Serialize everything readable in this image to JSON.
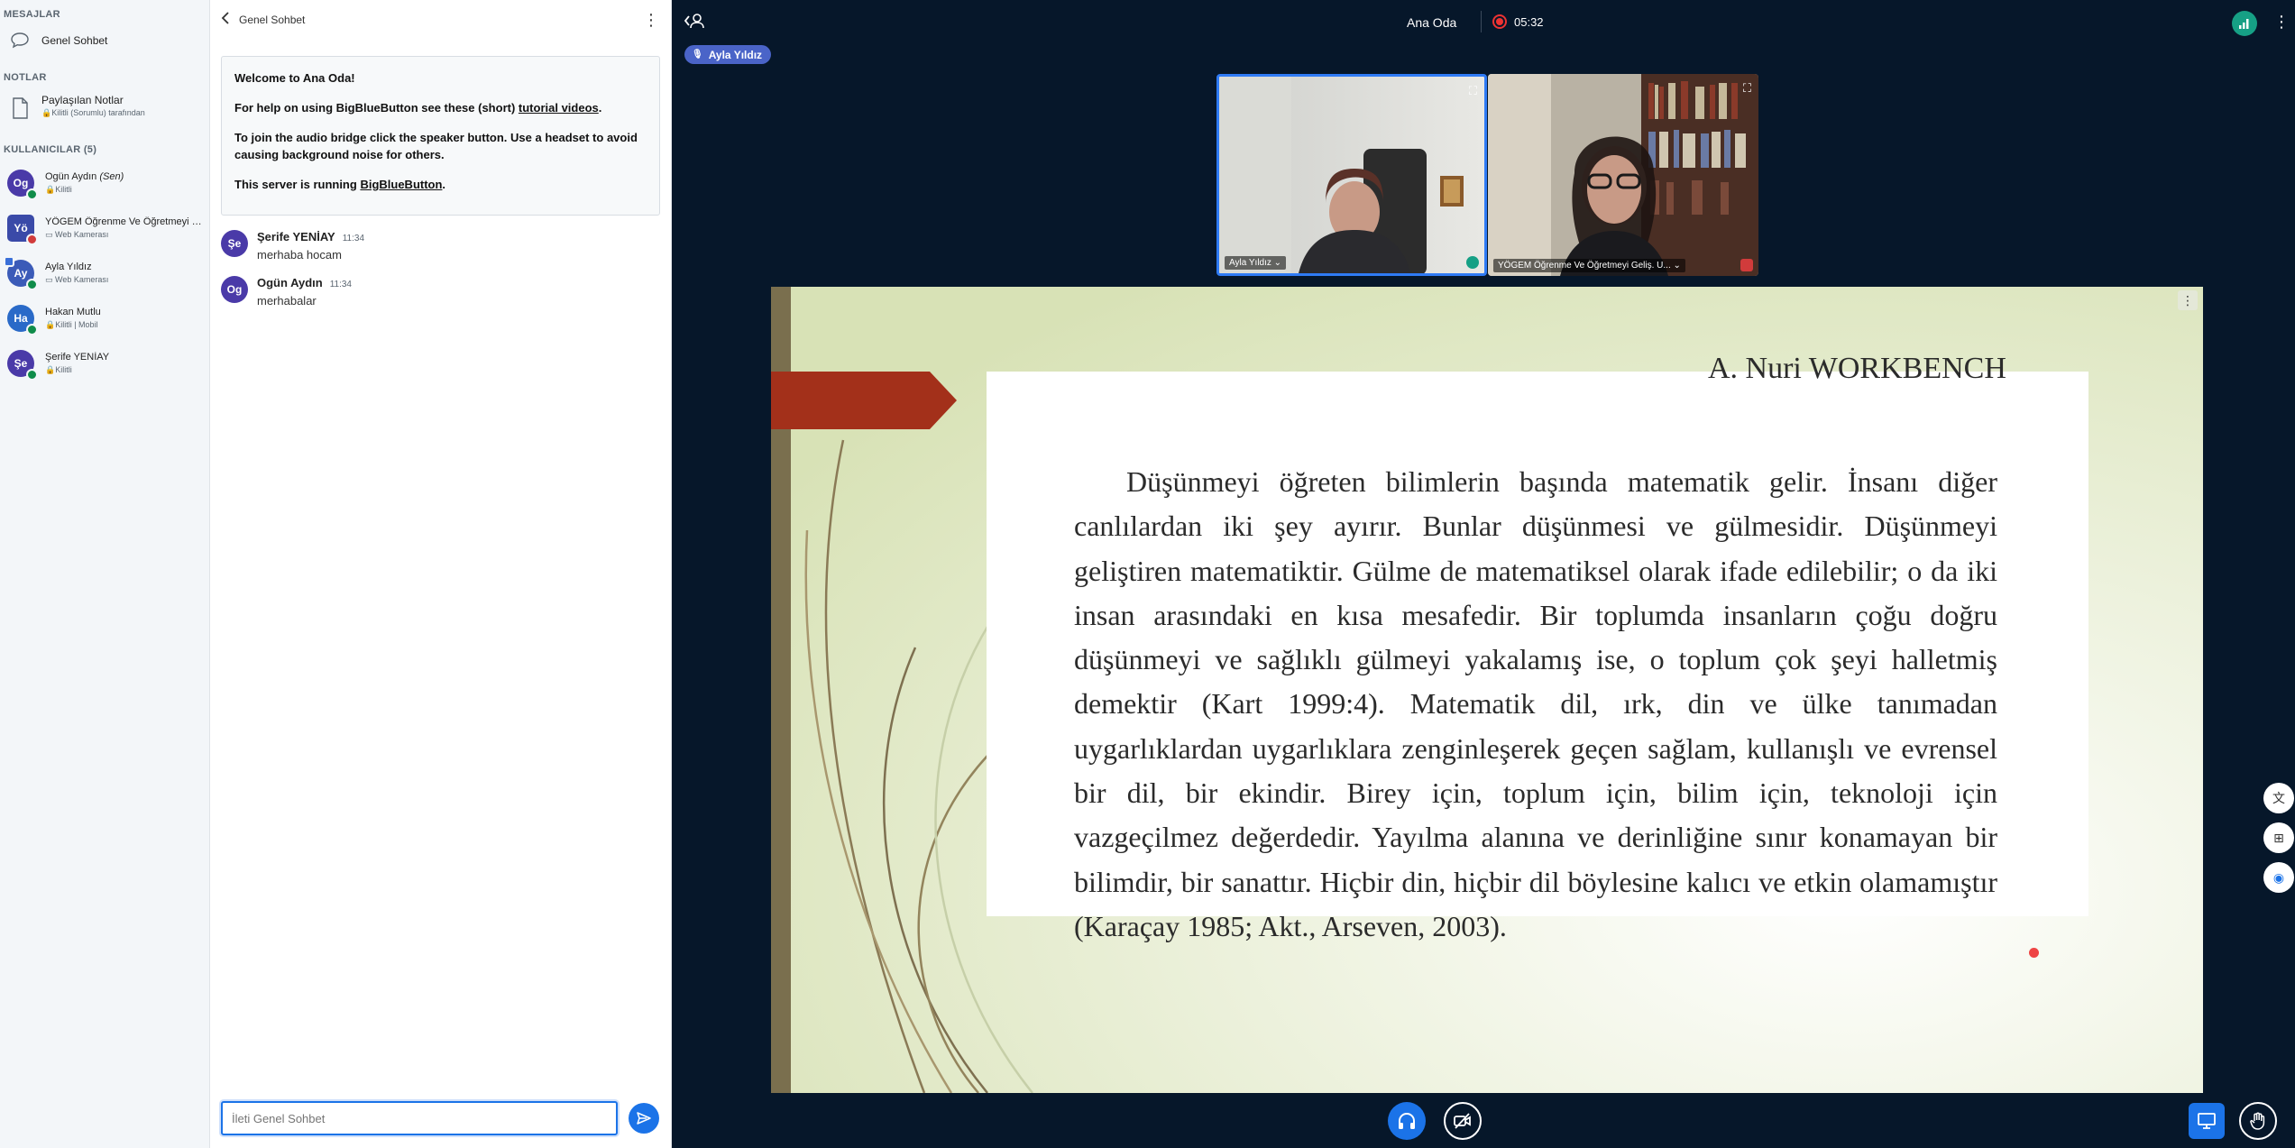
{
  "userlist": {
    "messages_title": "MESAJLAR",
    "public_chat_label": "Genel Sohbet",
    "notes_title": "NOTLAR",
    "shared_notes_label": "Paylaşılan Notlar",
    "shared_notes_sub": "Kilitli (Sorumlu) tarafından",
    "users_title": "KULLANICILAR (5)",
    "users": [
      {
        "initials": "Og",
        "name": "Ogün Aydın",
        "you": "(Sen)",
        "sub": "Kilitli",
        "color": "#4a3aa8"
      },
      {
        "initials": "Yö",
        "name": "YÖGEM Öğrenme Ve Öğretmeyi Geliş...",
        "sub": "Web Kamerası",
        "color": "#3a4aa8"
      },
      {
        "initials": "Ay",
        "name": "Ayla Yıldız",
        "sub": "Web Kamerası",
        "color": "#3b5bb8"
      },
      {
        "initials": "Ha",
        "name": "Hakan Mutlu",
        "sub": "Kilitli | Mobil",
        "color": "#2a6ac8"
      },
      {
        "initials": "Şe",
        "name": "Şerife YENİAY",
        "sub": "Kilitli",
        "color": "#4a3aa8"
      }
    ]
  },
  "chat": {
    "title": "Genel Sohbet",
    "welcome": {
      "line1": "Welcome to Ana Oda!",
      "line2_pre": "For help on using BigBlueButton see these (short) ",
      "line2_link": "tutorial videos",
      "line2_post": ".",
      "line3": "To join the audio bridge click the speaker button. Use a headset to avoid causing background noise for others.",
      "line4_pre": "This server is running ",
      "line4_link": "BigBlueButton",
      "line4_post": "."
    },
    "messages": [
      {
        "initials": "Şe",
        "name": "Şerife YENİAY",
        "time": "11:34",
        "text": "merhaba hocam",
        "color": "#4a3aa8"
      },
      {
        "initials": "Og",
        "name": "Ogün Aydın",
        "time": "11:34",
        "text": "merhabalar",
        "color": "#4a3aa8"
      }
    ],
    "input_placeholder": "İleti Genel Sohbet"
  },
  "main": {
    "room_name": "Ana Oda",
    "recording_time": "05:32",
    "talking_user": "Ayla Yıldız",
    "videos": [
      {
        "name": "Ayla Yıldız"
      },
      {
        "name": "YÖGEM Öğrenme Ve Öğretmeyi Geliş. U..."
      }
    ],
    "slide": {
      "cut_heading": "A. Nuri WORKBENCH",
      "paragraph": "Düşünmeyi öğreten bilimlerin başında matematik gelir. İnsanı diğer canlılardan iki şey ayırır. Bunlar düşünmesi ve gülmesidir. Düşünmeyi geliştiren matematiktir. Gülme de matematiksel olarak ifade edilebilir; o da iki insan arasındaki en kısa mesafedir. Bir toplumda insanların çoğu doğru düşünmeyi ve sağlıklı gülmeyi yakalamış ise, o toplum çok şeyi halletmiş demektir (Kart 1999:4). Matematik dil, ırk, din ve ülke tanımadan uygarlıklardan uygarlıklara zenginleşerek geçen sağlam, kullanışlı ve evrensel bir dil, bir ekindir. Birey için, toplum için, bilim için, teknoloji için vazgeçilmez değerdedir. Yayılma alanına ve derinliğine sınır konamayan bir bilimdir, bir sanattır. Hiçbir din, hiçbir dil böylesine kalıcı ve etkin olamamıştır (Karaçay 1985; Akt., Arseven, 2003)."
    }
  },
  "colors": {
    "accent": "#1b73e8",
    "app_bg": "#06172a",
    "connection": "#16a085",
    "recording": "#e33333",
    "slide_red": "#a3301a"
  }
}
